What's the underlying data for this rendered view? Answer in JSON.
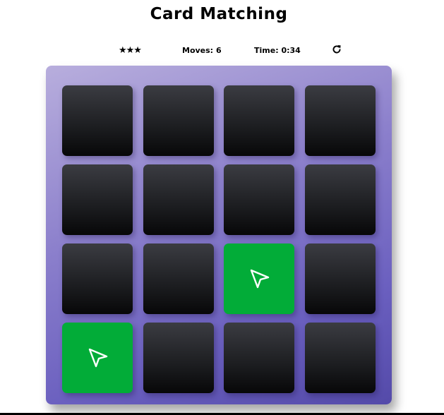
{
  "title": "Card Matching",
  "score": {
    "stars": "★★★",
    "moves_label": "Moves:",
    "moves_value": "6",
    "time_label": "Time:",
    "time_value": "0:34",
    "restart_icon": "redo-icon"
  },
  "deck": {
    "rows": 4,
    "cols": 4,
    "cards": [
      {
        "state": "hidden",
        "symbol": ""
      },
      {
        "state": "hidden",
        "symbol": ""
      },
      {
        "state": "hidden",
        "symbol": ""
      },
      {
        "state": "hidden",
        "symbol": ""
      },
      {
        "state": "hidden",
        "symbol": ""
      },
      {
        "state": "hidden",
        "symbol": ""
      },
      {
        "state": "hidden",
        "symbol": ""
      },
      {
        "state": "hidden",
        "symbol": ""
      },
      {
        "state": "hidden",
        "symbol": ""
      },
      {
        "state": "hidden",
        "symbol": ""
      },
      {
        "state": "match",
        "symbol": "paper-plane-icon"
      },
      {
        "state": "hidden",
        "symbol": ""
      },
      {
        "state": "match",
        "symbol": "paper-plane-icon"
      },
      {
        "state": "hidden",
        "symbol": ""
      },
      {
        "state": "hidden",
        "symbol": ""
      },
      {
        "state": "hidden",
        "symbol": ""
      }
    ]
  },
  "colors": {
    "match": "#02ac38",
    "card_back": "#1c1d20",
    "deck_top": "#b8aedd",
    "deck_bottom": "#544aa9"
  }
}
